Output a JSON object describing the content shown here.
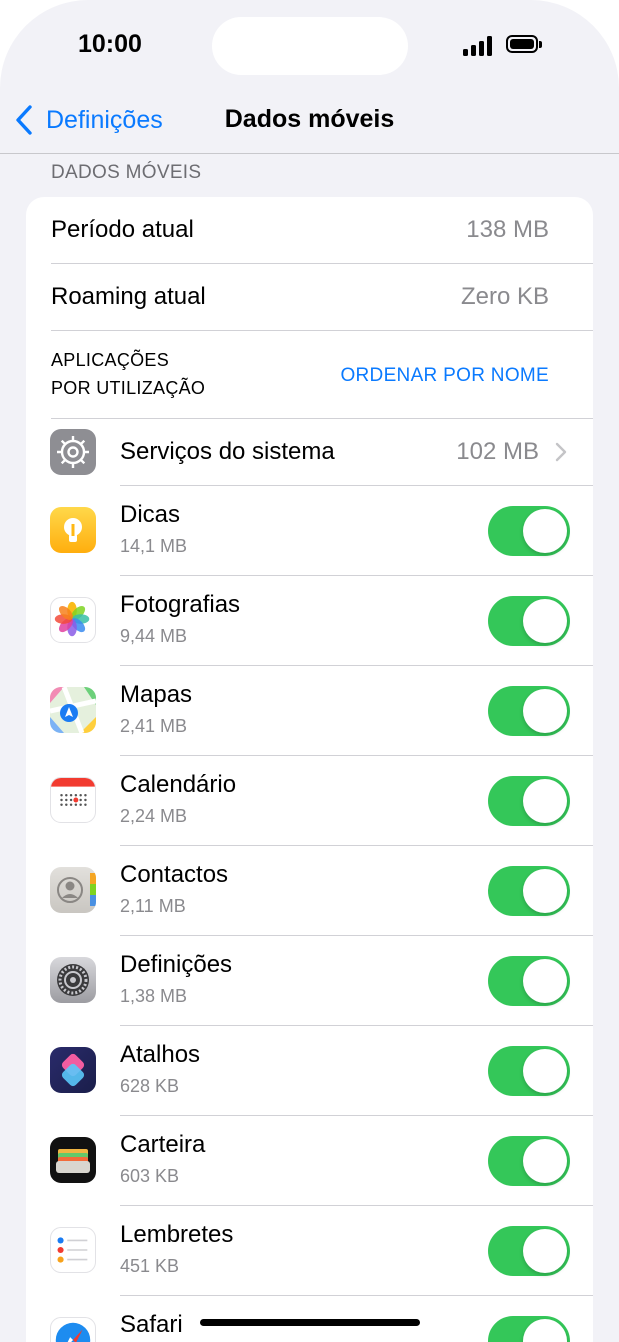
{
  "status": {
    "time": "10:00"
  },
  "nav": {
    "back_label": "Definições",
    "title": "Dados móveis"
  },
  "section_header": "DADOS MÓVEIS",
  "summary": [
    {
      "label": "Período atual",
      "value": "138 MB"
    },
    {
      "label": "Roaming atual",
      "value": "Zero KB"
    }
  ],
  "apps_header": {
    "line1": "APLICAÇÕES",
    "line2": "POR UTILIZAÇÃO",
    "sort_button": "ORDENAR POR NOME"
  },
  "system_services": {
    "label": "Serviços do sistema",
    "value": "102 MB"
  },
  "apps": [
    {
      "name": "Dicas",
      "size": "14,1 MB",
      "icon": "tips-icon",
      "enabled": true
    },
    {
      "name": "Fotografias",
      "size": "9,44 MB",
      "icon": "photos-icon",
      "enabled": true
    },
    {
      "name": "Mapas",
      "size": "2,41 MB",
      "icon": "maps-icon",
      "enabled": true
    },
    {
      "name": "Calendário",
      "size": "2,24 MB",
      "icon": "calendar-icon",
      "enabled": true
    },
    {
      "name": "Contactos",
      "size": "2,11 MB",
      "icon": "contacts-icon",
      "enabled": true
    },
    {
      "name": "Definições",
      "size": "1,38 MB",
      "icon": "settings-icon",
      "enabled": true
    },
    {
      "name": "Atalhos",
      "size": "628 KB",
      "icon": "shortcuts-icon",
      "enabled": true
    },
    {
      "name": "Carteira",
      "size": "603 KB",
      "icon": "wallet-icon",
      "enabled": true
    },
    {
      "name": "Lembretes",
      "size": "451 KB",
      "icon": "reminders-icon",
      "enabled": true
    },
    {
      "name": "Safari",
      "size": "",
      "icon": "safari-icon",
      "enabled": true
    }
  ],
  "colors": {
    "accent": "#0a7aff",
    "toggle_on": "#34c759",
    "background": "#f2f2f7"
  }
}
